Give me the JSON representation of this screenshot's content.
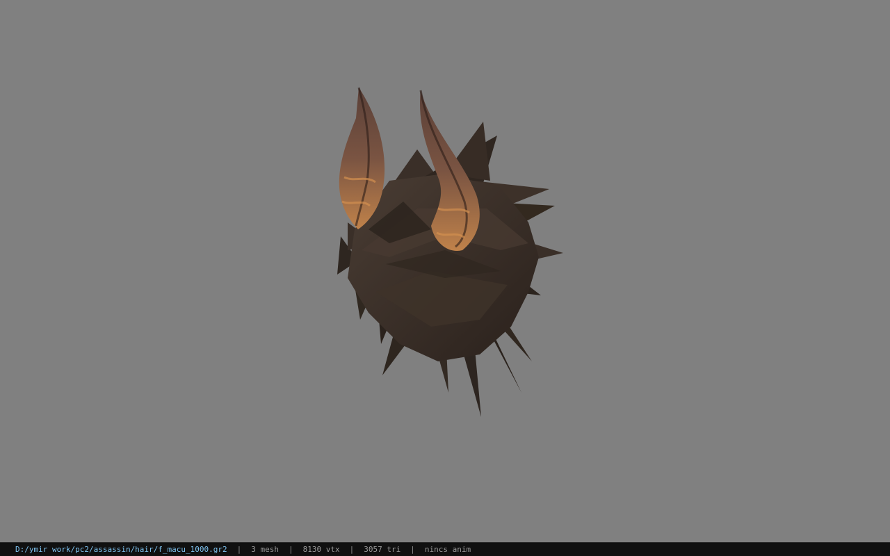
{
  "viewer": {
    "background_color": "#808080",
    "model_name": "hair-with-horns-model",
    "hair_color": "#3b2f28",
    "horn_color": "#6a4a3c"
  },
  "status": {
    "file_path": "D:/ymir work/pc2/assassin/hair/f_macu_1000.gr2",
    "separator": "|",
    "mesh_count": "3 mesh",
    "vertex_count": "8130 vtx",
    "triangle_count": "3057 tri",
    "anim_status": "nincs anim"
  }
}
